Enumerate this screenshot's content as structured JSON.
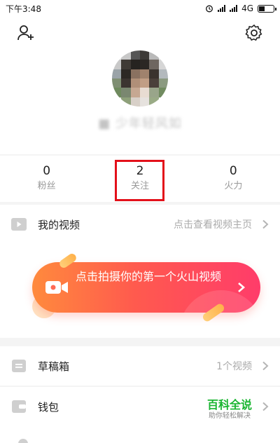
{
  "status_bar": {
    "time": "下午3:48",
    "network": "4G"
  },
  "profile": {
    "nickname": "■ 少年轻风如"
  },
  "stats": [
    {
      "count": "0",
      "label": "粉丝"
    },
    {
      "count": "2",
      "label": "关注"
    },
    {
      "count": "0",
      "label": "火力"
    }
  ],
  "my_videos": {
    "title": "我的视频",
    "hint": "点击查看视频主页"
  },
  "banner": {
    "text": "点击拍摄你的第一个火山视频"
  },
  "drafts": {
    "title": "草稿箱",
    "hint": "1个视频"
  },
  "wallet": {
    "title": "钱包"
  },
  "watermark": {
    "title": "百科全说",
    "subtitle": "助你轻松解决"
  },
  "colors": {
    "accent": "#ff4d57",
    "highlight_box": "#e3101a",
    "watermark": "#19b530"
  },
  "icons": [
    "add-user-icon",
    "settings-gear-icon",
    "video-play-icon",
    "draft-box-icon",
    "wallet-icon",
    "chevron-right-icon",
    "camera-icon"
  ]
}
